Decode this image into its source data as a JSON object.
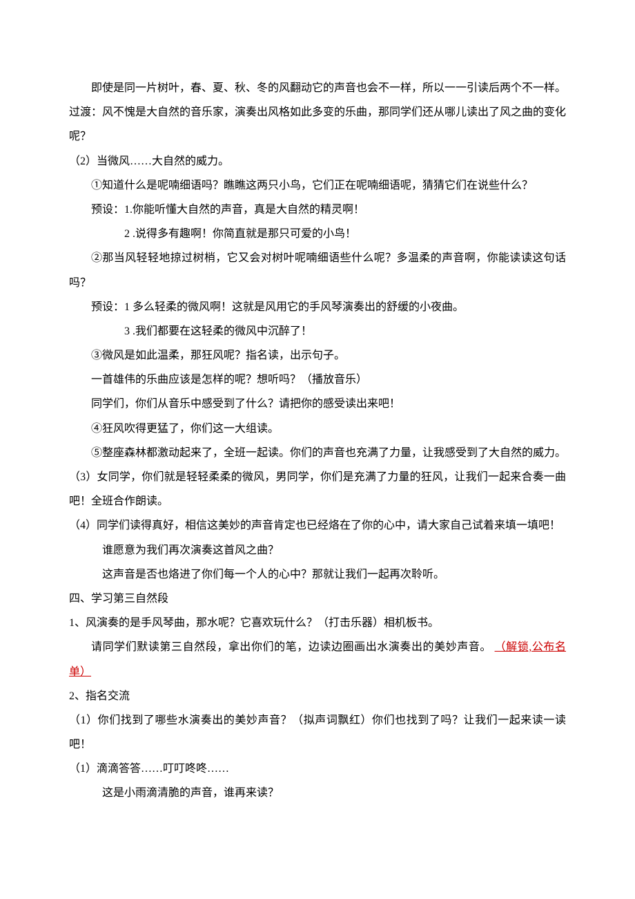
{
  "lines": {
    "l1": "即使是同一片树叶，春、夏、秋、冬的风翻动它的声音也会不一样，所以一一引读后两个不一样。",
    "l2": "过渡：风不愧是大自然的音乐家，演奏出风格如此多变的乐曲，那同学们还从哪儿读出了风之曲的变化呢？",
    "l3": "（2）当微风……大自然的威力。",
    "l4": "①知道什么是呢喃细语吗？瞧瞧这两只小鸟，它们正在呢喃细语呢，猜猜它们在说些什么？",
    "l5": "预设：1.你能听懂大自然的声音，真是大自然的精灵啊！",
    "l6": "2 .说得多有趣啊！你简直就是那只可爱的小鸟！",
    "l7": "②那当风轻轻地掠过树梢，它又会对树叶呢喃细语些什么呢？多温柔的声音啊，你能读读这句话吗？",
    "l8": "预设：1 多么轻柔的微风啊！这就是风用它的手风琴演奏出的舒缓的小夜曲。",
    "l9": "3 .我们都要在这轻柔的微风中沉醉了！",
    "l10": "③微风是如此温柔，那狂风呢？指名读，出示句子。",
    "l11": "一首雄伟的乐曲应该是怎样的呢？想听吗？（播放音乐）",
    "l12": "同学们，你们从音乐中感受到了什么？请把你的感受读出来吧！",
    "l13": "④狂风吹得更猛了，你们这一大组读。",
    "l14": "⑤整座森林都激动起来了，全班一起读。你们的声音也充满了力量，让我感受到了大自然的威力。",
    "l15": "（3）女同学，你们就是轻轻柔柔的微风，男同学，你们是充满了力量的狂风，让我们一起来合奏一曲吧！全班合作朗读。",
    "l16": "（4）同学们读得真好，相信这美妙的声音肯定也已经烙在了你的心中，请大家自己试着来填一填吧！",
    "l17": "谁愿意为我们再次演奏这首风之曲？",
    "l18": "这声音是否也烙进了你们每一个人的心中？那就让我们一起再次聆听。",
    "l19": "四、学习第三自然段",
    "l20": "1、风演奏的是手风琴曲，那水呢？它喜欢玩什么？（打击乐器）相机板书。",
    "l21_black": "请同学们默读第三自然段，拿出你们的笔，边读边圈画出水演奏出的美妙声音。",
    "l21_red": "（解锁,公布名单）",
    "l22": "2、指名交流",
    "l23": "（1）你们找到了哪些水演奏出的美妙声音？（拟声词飘红）你们也找到了吗？让我们一起来读一读吧！",
    "l24": "（1）滴滴答答……叮叮咚咚……",
    "l25": "这是小雨滴清脆的声音，谁再来读？"
  }
}
